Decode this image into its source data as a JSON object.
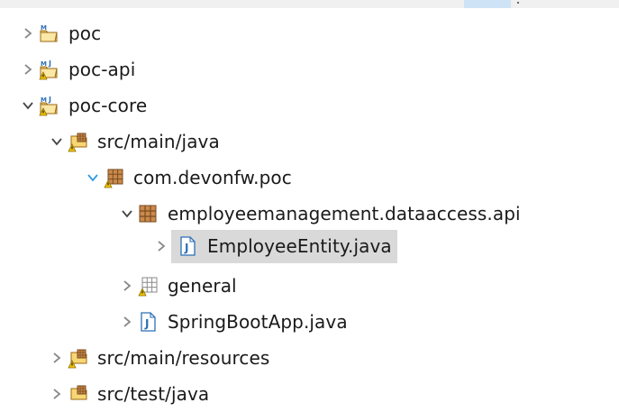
{
  "colors": {
    "chevron": "#8a8a8a",
    "chevron_active": "#2f9be0",
    "package_brown": "#9b5b2e",
    "java_blue": "#2c6fb7",
    "warning_yellow": "#f2c200",
    "selection_bg": "#d9d9d9"
  },
  "tree": {
    "items": [
      {
        "label": "poc",
        "state": "collapsed",
        "icon": "maven-project-icon"
      },
      {
        "label": "poc-api",
        "state": "collapsed",
        "icon": "maven-project-warning-icon"
      },
      {
        "label": "poc-core",
        "state": "expanded",
        "icon": "maven-project-warning-icon"
      },
      {
        "label": "src/main/java",
        "state": "expanded",
        "icon": "source-folder-warning-icon"
      },
      {
        "label": "com.devonfw.poc",
        "state": "expanded",
        "icon": "package-warning-icon"
      },
      {
        "label": "employeemanagement.dataaccess.api",
        "state": "expanded",
        "icon": "package-icon"
      },
      {
        "label": "EmployeeEntity.java",
        "state": "collapsed",
        "icon": "java-file-icon",
        "selected": true
      },
      {
        "label": "general",
        "state": "collapsed",
        "icon": "package-warning-icon"
      },
      {
        "label": "SpringBootApp.java",
        "state": "collapsed",
        "icon": "java-file-icon"
      },
      {
        "label": "src/main/resources",
        "state": "collapsed",
        "icon": "source-folder-warning-icon"
      },
      {
        "label": "src/test/java",
        "state": "collapsed",
        "icon": "source-folder-icon"
      }
    ]
  }
}
